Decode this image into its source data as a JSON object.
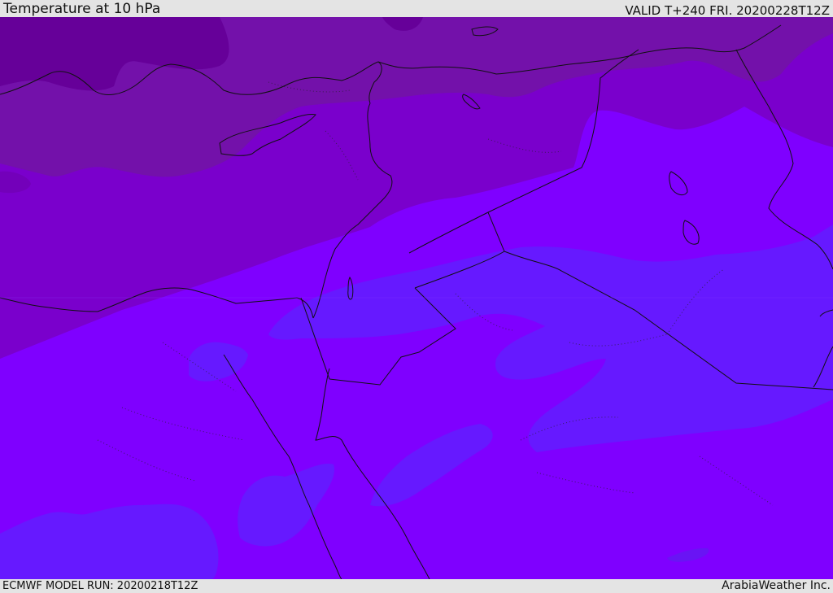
{
  "header": {
    "title": "Temperature at 10 hPa",
    "valid_time": "VALID T+240 FRI. 20200228T12Z"
  },
  "footer": {
    "model_run": "ECMWF MODEL RUN: 20200218T12Z",
    "credit": "ArabiaWeather Inc."
  },
  "map": {
    "field": "temperature",
    "level": "10 hPa",
    "region": "Eastern Mediterranean / Middle East",
    "colors": {
      "band_darkest": "#660099",
      "band_dark": "#7311aa",
      "band_mid": "#7a00cc",
      "band_violet": "#7f00ff",
      "band_blue": "#6619ff",
      "band_spot": "#5f1cf0",
      "coastline": "#111111"
    }
  }
}
